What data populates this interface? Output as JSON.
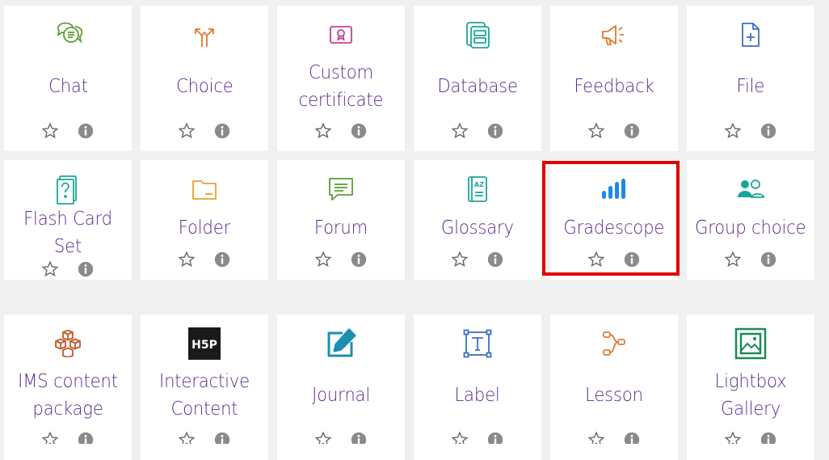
{
  "colors": {
    "label": "#5a2c8c",
    "background": "#f0f0f0",
    "tile": "#ffffff",
    "highlight": "#e00000",
    "star": "#6a6a6a",
    "info": "#8a8a8a"
  },
  "tiles": [
    {
      "label": "Chat",
      "icon": "chat-icon",
      "color": "#5a9e2f"
    },
    {
      "label": "Choice",
      "icon": "choice-icon",
      "color": "#e07a2e"
    },
    {
      "label": "Custom certificate",
      "icon": "certificate-icon",
      "color": "#c2409a"
    },
    {
      "label": "Database",
      "icon": "database-icon",
      "color": "#1aa59a"
    },
    {
      "label": "Feedback",
      "icon": "feedback-icon",
      "color": "#e07a2e"
    },
    {
      "label": "File",
      "icon": "file-icon",
      "color": "#3b6fc4"
    },
    {
      "label": "Flash Card Set",
      "icon": "flashcard-icon",
      "color": "#1aa59a"
    },
    {
      "label": "Folder",
      "icon": "folder-icon",
      "color": "#e8a030"
    },
    {
      "label": "Forum",
      "icon": "forum-icon",
      "color": "#5a9e2f"
    },
    {
      "label": "Glossary",
      "icon": "glossary-icon",
      "color": "#1aa59a"
    },
    {
      "label": "Gradescope",
      "icon": "gradescope-icon",
      "color": "#1e88e5"
    },
    {
      "label": "Group choice",
      "icon": "group-choice-icon",
      "color": "#1aa59a"
    },
    {
      "label": "IMS content package",
      "icon": "ims-package-icon",
      "color": "#c05a2a"
    },
    {
      "label": "Interactive Content",
      "icon": "h5p-icon",
      "color": "#000000"
    },
    {
      "label": "Journal",
      "icon": "journal-icon",
      "color": "#1a8fb0"
    },
    {
      "label": "Label",
      "icon": "label-icon",
      "color": "#3b6fc4"
    },
    {
      "label": "Lesson",
      "icon": "lesson-icon",
      "color": "#e07a2e"
    },
    {
      "label": "Lightbox Gallery",
      "icon": "gallery-icon",
      "color": "#1a8a5a"
    }
  ],
  "h5p_text": "H5P"
}
